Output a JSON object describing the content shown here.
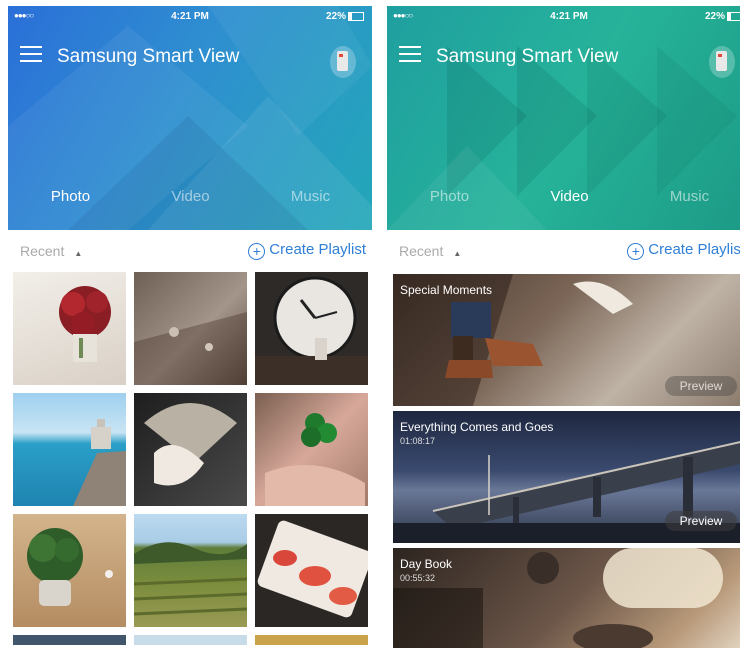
{
  "screens": [
    {
      "status": {
        "signal": "●●●○○",
        "time": "4:21 PM",
        "battery": "22%"
      },
      "app_title": "Samsung Smart View",
      "tabs": [
        "Photo",
        "Video",
        "Music"
      ],
      "active_tab": "Photo",
      "sort_label": "Recent",
      "create_playlist": "Create Playlist"
    },
    {
      "status": {
        "signal": "●●●○○",
        "time": "4:21 PM",
        "battery": "22%"
      },
      "app_title": "Samsung Smart View",
      "tabs": [
        "Photo",
        "Video",
        "Music"
      ],
      "active_tab": "Video",
      "sort_label": "Recent",
      "create_playlist": "Create Playlist",
      "videos": [
        {
          "title": "Special Moments",
          "duration": "",
          "action": "Preview"
        },
        {
          "title": "Everything Comes and Goes",
          "duration": "01:08:17",
          "action": "Preview"
        },
        {
          "title": "Day Book",
          "duration": "00:55:32",
          "action": ""
        }
      ]
    }
  ],
  "colors": {
    "accent": "#2f7fd6",
    "header_photo": "#2a6fd8",
    "header_video": "#1f9fa0"
  },
  "icons": {
    "menu": "hamburger-icon",
    "remote": "remote-control-icon",
    "sort": "caret-down-icon",
    "create": "plus-circle-icon"
  }
}
